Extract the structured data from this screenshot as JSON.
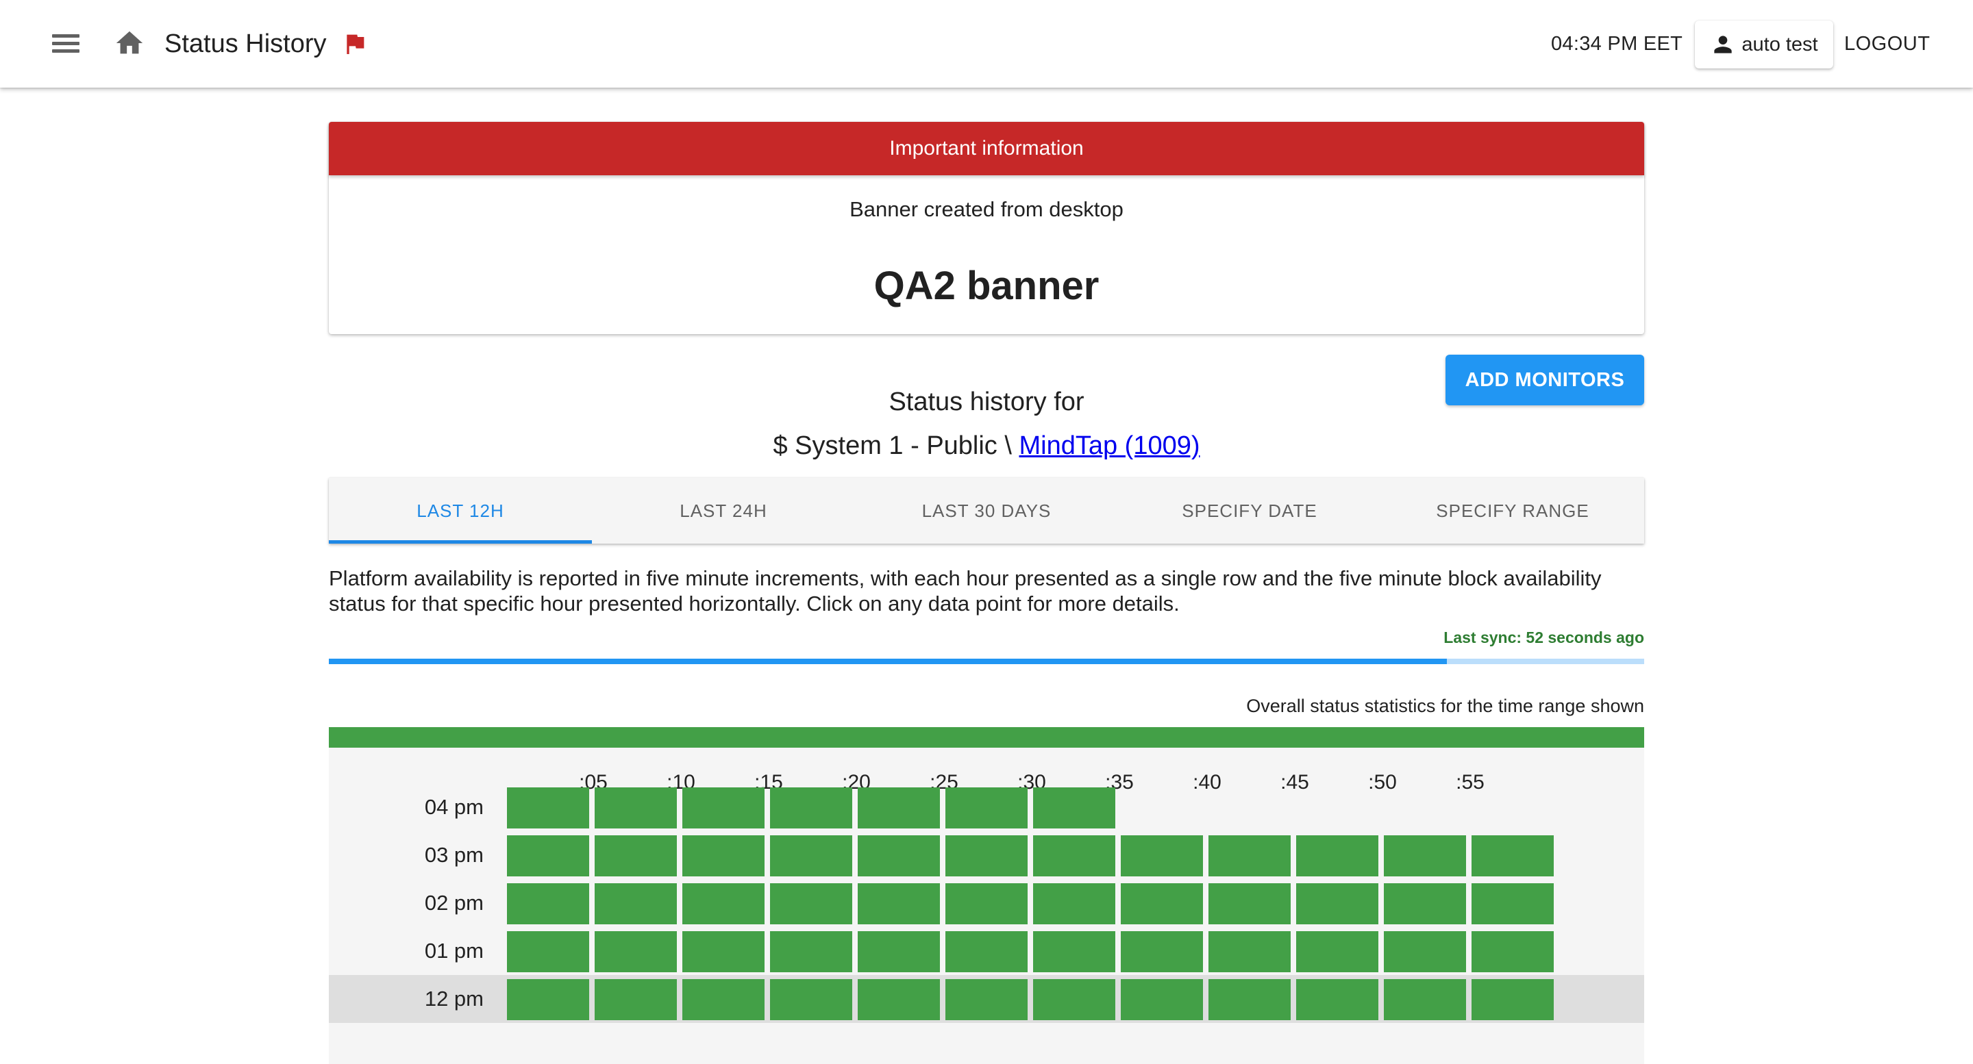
{
  "header": {
    "title": "Status History",
    "clock": "04:34 PM EET",
    "user": "auto test",
    "logout": "LOGOUT"
  },
  "banner": {
    "heading": "Important information",
    "subtitle": "Banner created from desktop",
    "title": "QA2 banner"
  },
  "add_monitors_label": "ADD MONITORS",
  "status_for": "Status history for",
  "system": {
    "prefix": "$ System 1 - Public \\ ",
    "link": "MindTap (1009)"
  },
  "tabs": [
    {
      "label": "LAST 12H",
      "active": true
    },
    {
      "label": "LAST 24H",
      "active": false
    },
    {
      "label": "LAST 30 DAYS",
      "active": false
    },
    {
      "label": "SPECIFY DATE",
      "active": false
    },
    {
      "label": "SPECIFY RANGE",
      "active": false
    }
  ],
  "description": "Platform availability is reported in five minute increments, with each hour presented as a single row and the five minute block availability status for that specific hour presented horizontally. Click on any data point for more details.",
  "sync": "Last sync: 52 seconds ago",
  "sync_progress": 0.85,
  "overall_label": "Overall status statistics for the time range shown",
  "minute_labels": [
    ":05",
    ":10",
    ":15",
    ":20",
    ":25",
    ":30",
    ":35",
    ":40",
    ":45",
    ":50",
    ":55"
  ],
  "hours": [
    {
      "label": "04 pm",
      "blocks": 7,
      "highlight": false
    },
    {
      "label": "03 pm",
      "blocks": 12,
      "highlight": false
    },
    {
      "label": "02 pm",
      "blocks": 12,
      "highlight": false
    },
    {
      "label": "01 pm",
      "blocks": 12,
      "highlight": false
    },
    {
      "label": "12 pm",
      "blocks": 12,
      "highlight": true
    }
  ],
  "colors": {
    "up": "#43a047",
    "accent": "#2196f3",
    "banner": "#c62828",
    "sync": "#2e7d32"
  },
  "icons": {
    "menu": "menu-icon",
    "home": "home-icon",
    "flag": "flag-icon",
    "user": "person-icon"
  }
}
